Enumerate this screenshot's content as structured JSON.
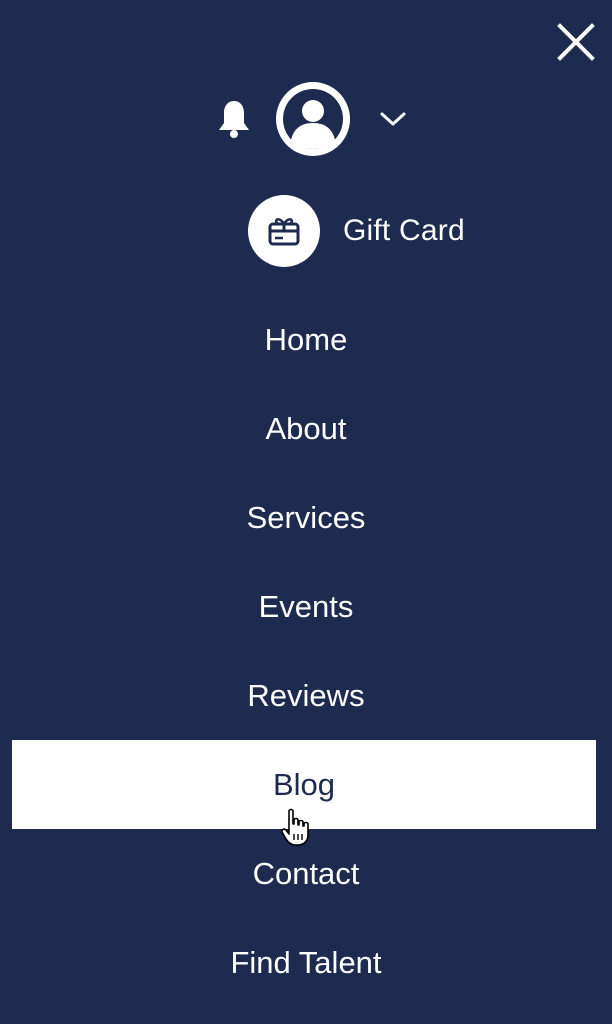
{
  "colors": {
    "background": "#1e2a4f",
    "text": "#ffffff",
    "active_background": "#ffffff",
    "active_text": "#1e2a4f"
  },
  "icons": {
    "close": "close-icon",
    "notifications": "bell-icon",
    "account": "user-avatar-icon",
    "account_menu": "chevron-down-icon",
    "gift": "gift-card-icon",
    "pointer": "hand-pointer-cursor"
  },
  "gift_card": {
    "label": "Gift Card"
  },
  "menu": {
    "items": [
      {
        "label": "Home",
        "active": false
      },
      {
        "label": "About",
        "active": false
      },
      {
        "label": "Services",
        "active": false
      },
      {
        "label": "Events",
        "active": false
      },
      {
        "label": "Reviews",
        "active": false
      },
      {
        "label": "Blog",
        "active": true
      },
      {
        "label": "Contact",
        "active": false
      },
      {
        "label": "Find Talent",
        "active": false
      }
    ]
  }
}
